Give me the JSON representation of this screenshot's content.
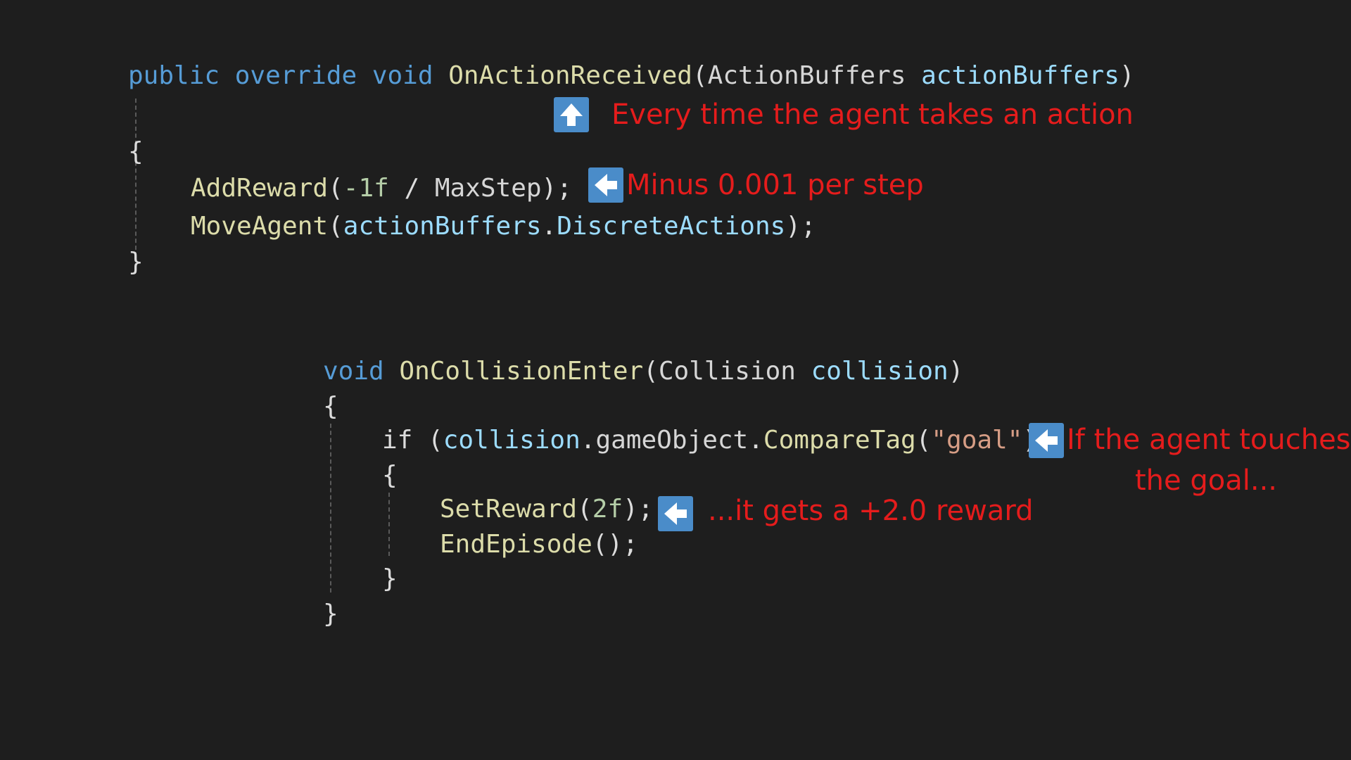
{
  "colors": {
    "background": "#1e1e1e",
    "keyword": "#569cd6",
    "function": "#dcdcaa",
    "variable": "#9cdcfe",
    "number": "#b5cea8",
    "string": "#d69d85",
    "annotation": "#e51c1c",
    "arrow_box": "#4a8cc9"
  },
  "block1": {
    "kw_public": "public",
    "kw_override": "override",
    "kw_void": "void",
    "method": "OnActionReceived",
    "open_paren": "(",
    "param_type": "ActionBuffers",
    "param_name": "actionBuffers",
    "close_paren": ")",
    "brace_open": "{",
    "line1_fn": "AddReward",
    "line1_open": "(",
    "line1_num": "-1f",
    "line1_op": " / ",
    "line1_var": "MaxStep",
    "line1_end": ");",
    "line2_fn": "MoveAgent",
    "line2_open": "(",
    "line2_var": "actionBuffers",
    "line2_dot": ".",
    "line2_member": "DiscreteActions",
    "line2_end": ");",
    "brace_close": "}"
  },
  "block2": {
    "kw_void": "void",
    "method": "OnCollisionEnter",
    "open_paren": "(",
    "param_type": "Collision",
    "param_name": "collision",
    "close_paren": ")",
    "brace_open": "{",
    "if_kw": "if",
    "if_open": " (",
    "if_var": "collision",
    "if_dot1": ".",
    "if_member": "gameObject",
    "if_dot2": ".",
    "if_fn": "CompareTag",
    "if_paren": "(",
    "if_str": "\"goal\"",
    "if_close": "))",
    "inner_brace_open": "{",
    "line1_fn": "SetReward",
    "line1_open": "(",
    "line1_num": "2f",
    "line1_end": ");",
    "line2_fn": "EndEpisode",
    "line2_end": "();",
    "inner_brace_close": "}",
    "brace_close": "}"
  },
  "annotations": {
    "every_action": "Every time the agent takes an action",
    "per_step": "Minus 0.001 per step",
    "touch_goal_line1": "If the agent touches",
    "touch_goal_line2": "the goal...",
    "reward": "...it gets a +2.0 reward"
  },
  "icons": {
    "up": "arrow-up-icon",
    "left": "arrow-left-icon"
  }
}
